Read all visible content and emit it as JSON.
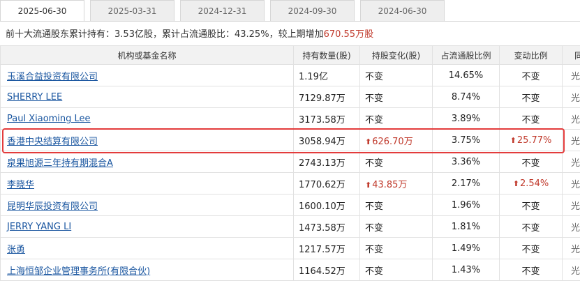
{
  "tabs": [
    "2025-06-30",
    "2025-03-31",
    "2024-12-31",
    "2024-09-30",
    "2024-06-30"
  ],
  "summary": {
    "prefix": "前十大流通股东累计持有：",
    "total_held": "3.53亿股",
    "mid": "，累计占流通股比：",
    "total_ratio": "43.25%",
    "mid2": "，较上期增加",
    "increase": "670.55万股"
  },
  "table": {
    "headers": [
      "机构或基金名称",
      "持有数量(股)",
      "持股变化(股)",
      "占流通股比例",
      "变动比例",
      "同"
    ],
    "rows": [
      {
        "name": "玉溪合益投资有限公司",
        "qty": "1.19亿",
        "change": "不变",
        "change_up": false,
        "pct": "14.65%",
        "rate": "不变",
        "rate_up": false,
        "extra": "光"
      },
      {
        "name": "SHERRY LEE",
        "qty": "7129.87万",
        "change": "不变",
        "change_up": false,
        "pct": "8.74%",
        "rate": "不变",
        "rate_up": false,
        "extra": "光"
      },
      {
        "name": "Paul Xiaoming Lee",
        "qty": "3173.58万",
        "change": "不变",
        "change_up": false,
        "pct": "3.89%",
        "rate": "不变",
        "rate_up": false,
        "extra": "光"
      },
      {
        "name": "香港中央结算有限公司",
        "qty": "3058.94万",
        "change": "626.70万",
        "change_up": true,
        "pct": "3.75%",
        "rate": "25.77%",
        "rate_up": true,
        "extra": "光"
      },
      {
        "name": "泉果旭源三年持有期混合A",
        "qty": "2743.13万",
        "change": "不变",
        "change_up": false,
        "pct": "3.36%",
        "rate": "不变",
        "rate_up": false,
        "extra": "光"
      },
      {
        "name": "李晓华",
        "qty": "1770.62万",
        "change": "43.85万",
        "change_up": true,
        "pct": "2.17%",
        "rate": "2.54%",
        "rate_up": true,
        "extra": "光"
      },
      {
        "name": "昆明华辰投资有限公司",
        "qty": "1600.10万",
        "change": "不变",
        "change_up": false,
        "pct": "1.96%",
        "rate": "不变",
        "rate_up": false,
        "extra": "光"
      },
      {
        "name": "JERRY YANG LI",
        "qty": "1473.58万",
        "change": "不变",
        "change_up": false,
        "pct": "1.81%",
        "rate": "不变",
        "rate_up": false,
        "extra": "光"
      },
      {
        "name": "张勇",
        "qty": "1217.57万",
        "change": "不变",
        "change_up": false,
        "pct": "1.49%",
        "rate": "不变",
        "rate_up": false,
        "extra": "光"
      },
      {
        "name": "上海恒邹企业管理事务所(有限合伙)",
        "qty": "1164.52万",
        "change": "不变",
        "change_up": false,
        "pct": "1.43%",
        "rate": "不变",
        "rate_up": false,
        "extra": "光"
      }
    ]
  },
  "colors": {
    "up": "#c0392b",
    "link": "#1a56a0",
    "highlight": "#e33b3b"
  },
  "icons": {
    "increase": "arrow-up-icon"
  }
}
